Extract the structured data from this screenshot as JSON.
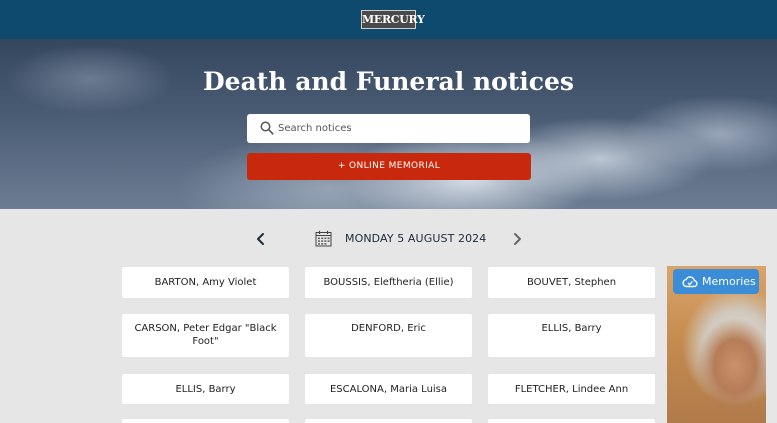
{
  "header": {
    "logo_text": "MERCURY"
  },
  "hero": {
    "title": "Death and Funeral notices",
    "search_placeholder": "Search notices",
    "memorial_button": "+ ONLINE MEMORIAL"
  },
  "date_nav": {
    "date": "MONDAY 5 AUGUST 2024"
  },
  "notices": [
    "BARTON, Amy Violet",
    "BOUSSIS, Eleftheria (Ellie)",
    "BOUVET, Stephen",
    "CARSON, Peter Edgar \"Black Foot\"",
    "DENFORD, Eric",
    "ELLIS, Barry",
    "ELLIS, Barry",
    "ESCALONA, Maria Luisa",
    "FLETCHER, Lindee Ann"
  ],
  "ad": {
    "button_label": "Memories"
  },
  "colors": {
    "header": "#0e4a6e",
    "memorial_button": "#c8290c",
    "memories_button": "#3a8dd6",
    "background": "#e6e6e6"
  }
}
